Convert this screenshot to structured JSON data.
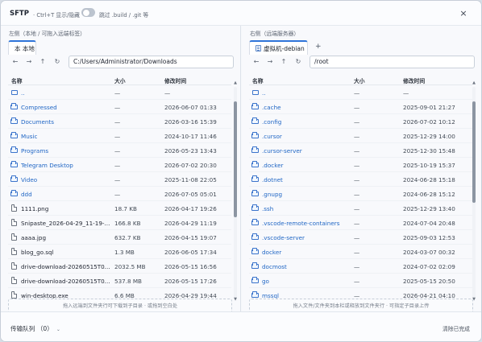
{
  "app": {
    "title": "SFTP",
    "shortcut": "· Ctrl+T 显示/隐藏",
    "skip_label": "跳过 .build / .git 等",
    "close_icon": "close-icon"
  },
  "left_pane": {
    "caption": "左侧（本地 / 可拖入远端标签）",
    "tab": "本 本地",
    "path": "C:/Users/Administrator/Downloads",
    "headers": {
      "name": "名称",
      "size": "大小",
      "modified": "修改时间"
    },
    "rows": [
      {
        "type": "up",
        "name": "..",
        "size": "—",
        "modified": "—"
      },
      {
        "type": "folder",
        "name": "Compressed",
        "size": "—",
        "modified": "2026-06-07 01:33"
      },
      {
        "type": "folder",
        "name": "Documents",
        "size": "—",
        "modified": "2026-03-16 15:39"
      },
      {
        "type": "folder",
        "name": "Music",
        "size": "—",
        "modified": "2024-10-17 11:46"
      },
      {
        "type": "folder",
        "name": "Programs",
        "size": "—",
        "modified": "2026-05-23 13:43"
      },
      {
        "type": "folder",
        "name": "Telegram Desktop",
        "size": "—",
        "modified": "2026-07-02 20:30"
      },
      {
        "type": "folder",
        "name": "Video",
        "size": "—",
        "modified": "2025-11-08 22:05"
      },
      {
        "type": "folder",
        "name": "ddd",
        "size": "—",
        "modified": "2026-07-05 05:01"
      },
      {
        "type": "file",
        "name": "1111.png",
        "size": "18.7 KB",
        "modified": "2026-04-17 19:26"
      },
      {
        "type": "file",
        "name": "Snipaste_2026-04-29_11-19-...",
        "size": "166.8 KB",
        "modified": "2026-04-29 11:19"
      },
      {
        "type": "file",
        "name": "aaaa.jpg",
        "size": "632.7 KB",
        "modified": "2026-04-15 19:07"
      },
      {
        "type": "file",
        "name": "blog_go.sql",
        "size": "1.3 MB",
        "modified": "2026-06-05 17:34"
      },
      {
        "type": "file",
        "name": "drive-download-20260515T0...",
        "size": "2032.5 MB",
        "modified": "2026-05-15 16:56"
      },
      {
        "type": "file",
        "name": "drive-download-20260515T0...",
        "size": "537.8 MB",
        "modified": "2026-05-15 17:26"
      },
      {
        "type": "file",
        "name": "win-desktop.exe",
        "size": "6.6 MB",
        "modified": "2026-04-29 19:44"
      }
    ],
    "dropzone": "拖入远端到文件夹行可下载到子目录 · 或拖到空白处"
  },
  "right_pane": {
    "caption": "右侧（远端服务器）",
    "tab": "虚拟机-debian",
    "add_tab": "+",
    "path": "/root",
    "headers": {
      "name": "名称",
      "size": "大小",
      "modified": "修改时间"
    },
    "rows": [
      {
        "type": "up",
        "name": "..",
        "size": "—",
        "modified": "—"
      },
      {
        "type": "folder",
        "name": ".cache",
        "size": "—",
        "modified": "2025-09-01 21:27"
      },
      {
        "type": "folder",
        "name": ".config",
        "size": "—",
        "modified": "2026-07-02 10:12"
      },
      {
        "type": "folder",
        "name": ".cursor",
        "size": "—",
        "modified": "2025-12-29 14:00"
      },
      {
        "type": "folder",
        "name": ".cursor-server",
        "size": "—",
        "modified": "2025-12-30 15:48"
      },
      {
        "type": "folder",
        "name": ".docker",
        "size": "—",
        "modified": "2025-10-19 15:37"
      },
      {
        "type": "folder",
        "name": ".dotnet",
        "size": "—",
        "modified": "2024-06-28 15:18"
      },
      {
        "type": "folder",
        "name": ".gnupg",
        "size": "—",
        "modified": "2024-06-28 15:12"
      },
      {
        "type": "folder",
        "name": ".ssh",
        "size": "—",
        "modified": "2025-12-29 13:40"
      },
      {
        "type": "folder",
        "name": ".vscode-remote-containers",
        "size": "—",
        "modified": "2024-07-04 20:48"
      },
      {
        "type": "folder",
        "name": ".vscode-server",
        "size": "—",
        "modified": "2025-09-03 12:53"
      },
      {
        "type": "folder",
        "name": "docker",
        "size": "—",
        "modified": "2024-03-07 00:32"
      },
      {
        "type": "folder",
        "name": "docmost",
        "size": "—",
        "modified": "2024-07-02 02:09"
      },
      {
        "type": "folder",
        "name": "go",
        "size": "—",
        "modified": "2025-05-15 20:50"
      },
      {
        "type": "folder",
        "name": "mssql",
        "size": "—",
        "modified": "2026-04-21 04:10"
      }
    ],
    "dropzone": "拖入文件/文件夹到本栏或释放到文件夹行 · 可指定子目录上传"
  },
  "statusbar": {
    "queue_label": "传输队列 （0）",
    "queue_caret": "⌄",
    "clear_done": "清除已完成"
  },
  "scroll": {
    "left_thumb_fraction": 0.55,
    "right_thumb_fraction": 0.48
  }
}
